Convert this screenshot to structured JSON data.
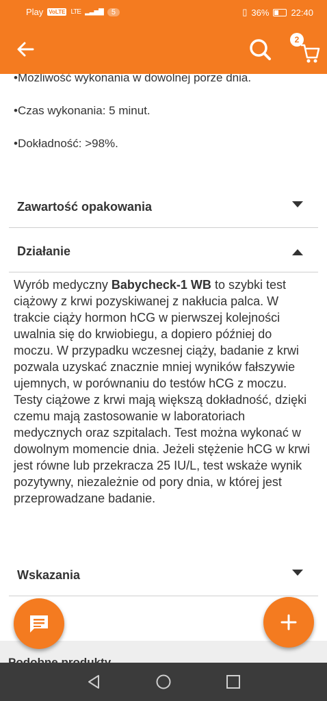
{
  "status_bar": {
    "carrier": "Play",
    "volte": "VoLTE",
    "network": "LTE",
    "notification_count": "5",
    "battery": "36%",
    "time": "22:40"
  },
  "app_bar": {
    "cart_count": "2"
  },
  "features": [
    "•Możliwość wykonania w dowolnej porze dnia.",
    "•Czas wykonania: 5 minut.",
    "•Dokładność: >98%."
  ],
  "sections": {
    "contents": "Zawartość opakowania",
    "action": "Działanie",
    "indications": "Wskazania"
  },
  "description": {
    "prefix": "Wyrób medyczny ",
    "product": "Babycheck-1 WB",
    "body": " to szybki test ciążowy z krwi pozyskiwanej z nakłucia palca. W trakcie ciąży hormon hCG w pierwszej kolejności uwalnia się do krwiobiegu, a dopiero później do moczu. W przypadku wczesnej ciąży, badanie z krwi pozwala uzyskać znacznie mniej wyników fałszywie ujemnych, w porównaniu do testów hCG z moczu. Testy ciążowe z krwi mają większą dokładność, dzięki czemu mają zastosowanie w laboratoriach medycznych oraz szpitalach. Test można wykonać w dowolnym momencie dnia. Jeżeli stężenie hCG w krwi jest równe lub przekracza 25 IU/L, test wskaże wynik pozytywny, niezależnie od pory dnia, w której jest przeprowadzane badanie."
  },
  "similar_products": "Podobne produkty",
  "colors": {
    "accent": "#f47b20",
    "navbar": "#3b3b3b"
  },
  "icons": {
    "back": "arrow-left-icon",
    "search": "search-icon",
    "cart": "cart-icon",
    "chat": "chat-icon",
    "add": "plus-icon"
  }
}
